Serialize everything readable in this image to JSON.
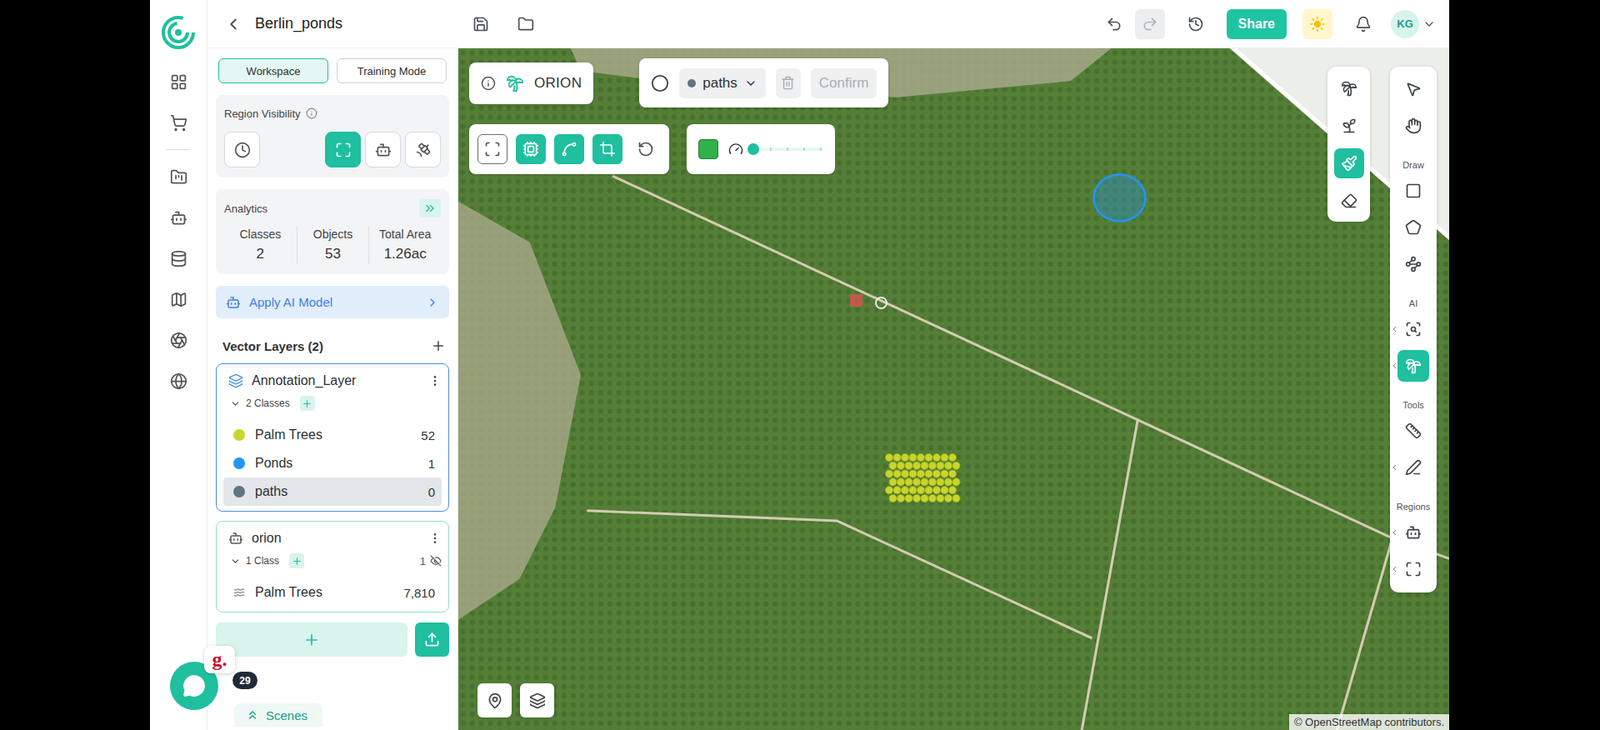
{
  "topbar": {
    "title": "Berlin_ponds",
    "undo": {
      "disabled": false
    },
    "redo": {
      "disabled": true
    },
    "share": "Share",
    "user": {
      "initials": "KG"
    }
  },
  "panel": {
    "tabs": [
      {
        "label": "Workspace",
        "selected": true
      },
      {
        "label": "Training Mode",
        "selected": false
      }
    ],
    "region_visibility": {
      "title": "Region Visibility",
      "buttons": [
        {
          "kind": "timeline",
          "selected": false
        },
        {
          "kind": "extent",
          "selected": true
        },
        {
          "kind": "ai",
          "selected": false
        },
        {
          "kind": "custom",
          "selected": false
        }
      ]
    },
    "analytics": {
      "title": "Analytics",
      "stats": [
        {
          "label": "Classes",
          "value": "2"
        },
        {
          "label": "Objects",
          "value": "53"
        },
        {
          "label": "Total Area",
          "value": "1.26ac"
        }
      ]
    },
    "apply_ai": {
      "label": "Apply AI Model"
    },
    "vector_layers": {
      "title": "Vector Layers (2)",
      "layers": [
        {
          "name": "Annotation_Layer",
          "kind": "annotation",
          "selected": true,
          "expanded": true,
          "classes_label": "2 Classes",
          "classes": [
            {
              "name": "Palm Trees",
              "count": "52",
              "color": "#c8d52c",
              "selected": false
            },
            {
              "name": "Ponds",
              "count": "1",
              "color": "#2196f3",
              "selected": false
            },
            {
              "name": "paths",
              "count": "0",
              "color": "#5f7680",
              "selected": true
            }
          ]
        },
        {
          "name": "orion",
          "kind": "ai",
          "selected": false,
          "expanded": true,
          "classes_label": "1 Class",
          "visibility": {
            "count": "1",
            "hidden": true
          },
          "classes": [
            {
              "name": "Palm Trees",
              "count": "7,810",
              "selected": false
            }
          ]
        }
      ]
    },
    "scenes": {
      "label": "Scenes"
    }
  },
  "support": {
    "brand": "g.",
    "badge": "29"
  },
  "map": {
    "orion": {
      "label": "ORION"
    },
    "class_selector": {
      "value": "paths",
      "color": "#5f7680"
    },
    "delete": {
      "disabled": true
    },
    "confirm": {
      "label": "Confirm",
      "disabled": true
    },
    "tools": [
      {
        "kind": "focus",
        "selected": false
      },
      {
        "kind": "chip",
        "selected": true
      },
      {
        "kind": "curve",
        "selected": true
      },
      {
        "kind": "crop",
        "selected": true
      },
      {
        "kind": "reset",
        "selected": false
      }
    ],
    "brush": {
      "color": "#2fb24a",
      "level": 0
    },
    "side_tools": [
      {
        "kind": "palm-layer",
        "selected": false
      },
      {
        "kind": "palm-stack",
        "selected": false
      },
      {
        "kind": "brush",
        "selected": true
      },
      {
        "kind": "eraser",
        "selected": false
      }
    ],
    "toolbar_groups": [
      {
        "items": [
          {
            "kind": "pointer",
            "selected": false,
            "expandable": false
          },
          {
            "kind": "hand",
            "selected": false,
            "expandable": false
          }
        ]
      },
      {
        "title": "Draw",
        "items": [
          {
            "kind": "rectangle",
            "selected": false,
            "expandable": false
          },
          {
            "kind": "polygon",
            "selected": false,
            "expandable": false
          },
          {
            "kind": "network",
            "selected": false,
            "expandable": false
          }
        ]
      },
      {
        "title": "AI",
        "items": [
          {
            "kind": "scan",
            "selected": false,
            "expandable": true
          },
          {
            "kind": "palm",
            "selected": true,
            "expandable": true
          }
        ]
      },
      {
        "title": "Tools",
        "items": [
          {
            "kind": "ruler",
            "selected": false,
            "expandable": false
          },
          {
            "kind": "pen",
            "selected": false,
            "expandable": true
          }
        ]
      },
      {
        "title": "Regions",
        "items": [
          {
            "kind": "robot",
            "selected": false,
            "expandable": true
          },
          {
            "kind": "fullscreen",
            "selected": false,
            "expandable": true
          }
        ]
      }
    ],
    "attribution": "© OpenStreetMap contributors."
  }
}
